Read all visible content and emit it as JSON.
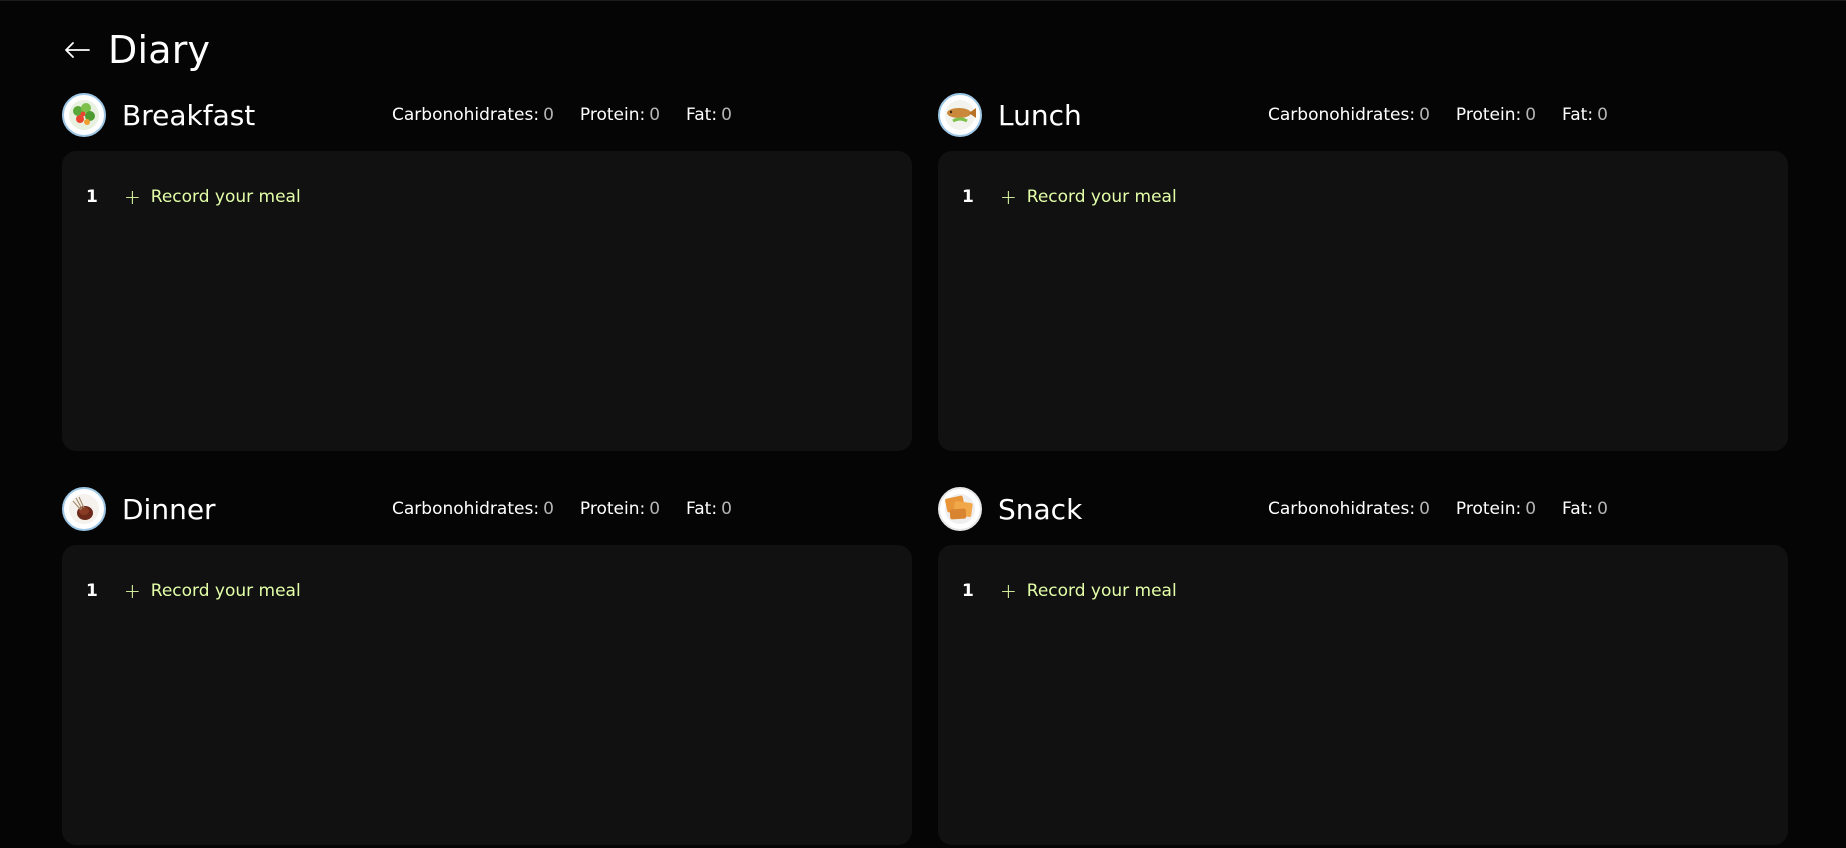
{
  "header": {
    "title": "Diary",
    "back_icon": "arrow-left-icon"
  },
  "accent_color": "#E3FFA8",
  "meals": [
    {
      "name": "Breakfast",
      "icon": "salad-plate-icon",
      "carbs_label": "Carbonohidrates:",
      "carbs_value": "0",
      "protein_label": "Protein:",
      "protein_value": "0",
      "fat_label": "Fat:",
      "fat_value": "0",
      "row_index": "1",
      "record_label": "Record your meal"
    },
    {
      "name": "Lunch",
      "icon": "fish-plate-icon",
      "carbs_label": "Carbonohidrates:",
      "carbs_value": "0",
      "protein_label": "Protein:",
      "protein_value": "0",
      "fat_label": "Fat:",
      "fat_value": "0",
      "row_index": "1",
      "record_label": "Record your meal"
    },
    {
      "name": "Dinner",
      "icon": "steak-plate-icon",
      "carbs_label": "Carbonohidrates:",
      "carbs_value": "0",
      "protein_label": "Protein:",
      "protein_value": "0",
      "fat_label": "Fat:",
      "fat_value": "0",
      "row_index": "1",
      "record_label": "Record your meal"
    },
    {
      "name": "Snack",
      "icon": "crackers-plate-icon",
      "carbs_label": "Carbonohidrates:",
      "carbs_value": "0",
      "protein_label": "Protein:",
      "protein_value": "0",
      "fat_label": "Fat:",
      "fat_value": "0",
      "row_index": "1",
      "record_label": "Record your meal"
    }
  ]
}
